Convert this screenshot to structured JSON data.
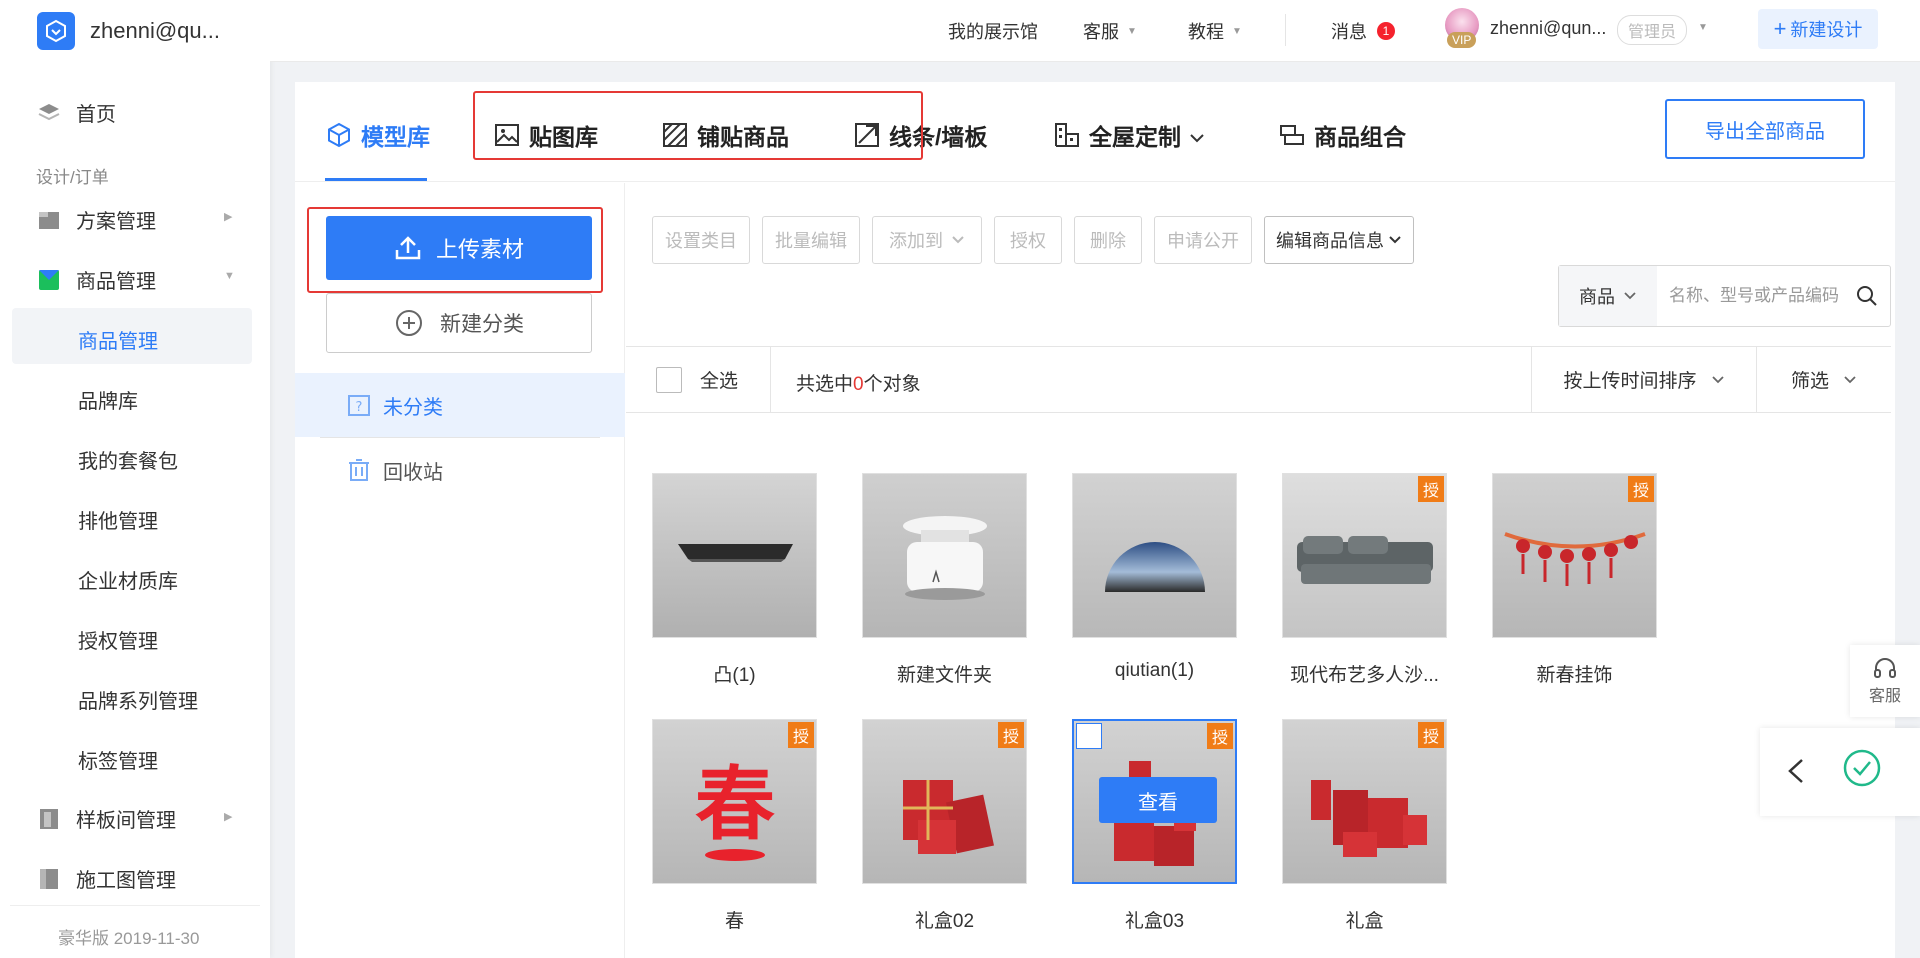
{
  "account": {
    "short_name": "zhenni@qu..."
  },
  "sidebar": {
    "home": "首页",
    "section_label": "设计/订单",
    "scheme_mgmt": "方案管理",
    "product_mgmt": "商品管理",
    "sub_items": [
      "商品管理",
      "品牌库",
      "我的套餐包",
      "排他管理",
      "企业材质库",
      "授权管理",
      "品牌系列管理",
      "标签管理"
    ],
    "showroom_mgmt": "样板间管理",
    "drawing_mgmt": "施工图管理",
    "version": "豪华版 2019-11-30"
  },
  "header": {
    "gallery": "我的展示馆",
    "service": "客服",
    "tutorial": "教程",
    "messages": "消息",
    "message_count": "1",
    "user_name": "zhenni@qun...",
    "vip": "VIP",
    "role": "管理员",
    "new_design": "新建设计"
  },
  "tabs": {
    "model_lib": "模型库",
    "texture_lib": "贴图库",
    "tile_products": "铺贴商品",
    "lines_walls": "线条/墙板",
    "whole_house": "全屋定制",
    "product_combo": "商品组合",
    "export_all": "导出全部商品"
  },
  "category": {
    "upload": "上传素材",
    "new_category": "新建分类",
    "uncategorized": "未分类",
    "recycle_bin": "回收站"
  },
  "toolbar": {
    "set_category": "设置类目",
    "batch_edit": "批量编辑",
    "add_to": "添加到",
    "authorize": "授权",
    "delete": "删除",
    "apply_public": "申请公开",
    "edit_info": "编辑商品信息"
  },
  "search": {
    "type": "商品",
    "placeholder": "名称、型号或产品编码"
  },
  "selection": {
    "select_all": "全选",
    "count_prefix": "共选中",
    "count": "0",
    "count_suffix": "个对象",
    "sort": "按上传时间排序",
    "filter": "筛选"
  },
  "products": [
    {
      "name": "凸(1)",
      "authorized": false
    },
    {
      "name": "新建文件夹",
      "authorized": false
    },
    {
      "name": "qiutian(1)",
      "authorized": false
    },
    {
      "name": "现代布艺多人沙...",
      "authorized": true
    },
    {
      "name": "新春挂饰",
      "authorized": true
    },
    {
      "name": "春",
      "authorized": true
    },
    {
      "name": "礼盒02",
      "authorized": true
    },
    {
      "name": "礼盒03",
      "authorized": true
    },
    {
      "name": "礼盒",
      "authorized": true
    }
  ],
  "auth_badge": "授",
  "view_label": "查看",
  "float": {
    "service": "客服"
  },
  "colors": {
    "accent": "#2e7cf6",
    "auth_badge": "#f07c17",
    "highlight_box": "#e53935",
    "badge_red": "#f5222d"
  }
}
